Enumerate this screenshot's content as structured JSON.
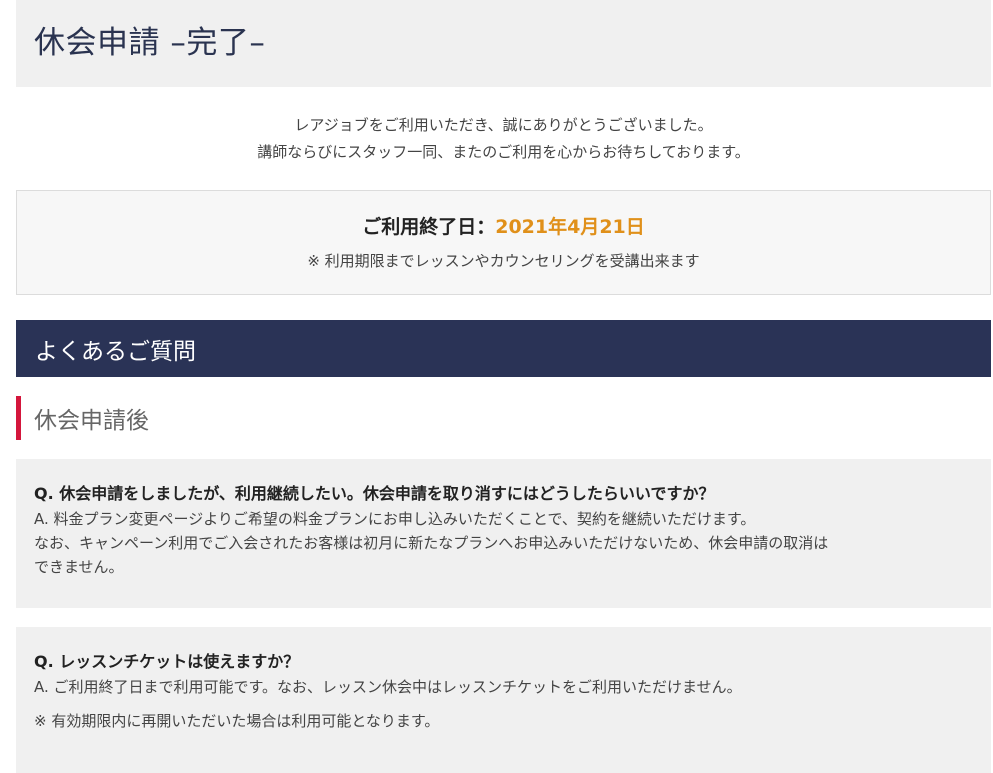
{
  "header": {
    "title": "休会申請 –完了–"
  },
  "thanks": {
    "line1": "レアジョブをご利用いただき、誠にありがとうございました。",
    "line2": "講師ならびにスタッフ一同、またのご利用を心からお待ちしております。"
  },
  "end_box": {
    "label": "ご利用終了日：",
    "date": "2021年4月21日",
    "note": "※ 利用期限までレッスンやカウンセリングを受講出来ます",
    "date_color": "#e0901a"
  },
  "faq": {
    "heading": "よくあるご質問",
    "section_title": "休会申請後",
    "items": [
      {
        "question": "Q. 休会申請をしましたが、利用継続したい。休会申請を取り消すにはどうしたらいいですか？",
        "answer_lines": [
          "A. 料金プラン変更ページよりご希望の料金プランにお申し込みいただくことで、契約を継続いただけます。",
          "なお、キャンペーン利用でご入会されたお客様は初月に新たなプランへお申込みいただけないため、休会申請の取消は",
          "できません。"
        ]
      },
      {
        "question": "Q. レッスンチケットは使えますか？",
        "answer_lines": [
          "A. ご利用終了日まで利用可能です。なお、レッスン休会中はレッスンチケットをご利用いただけません。",
          "※ 有効期限内に再開いただいた場合は利用可能となります。"
        ]
      }
    ]
  },
  "colors": {
    "faq_bar": "#2a3356",
    "section_accent": "#d4163c",
    "title_text": "#2a3350"
  }
}
